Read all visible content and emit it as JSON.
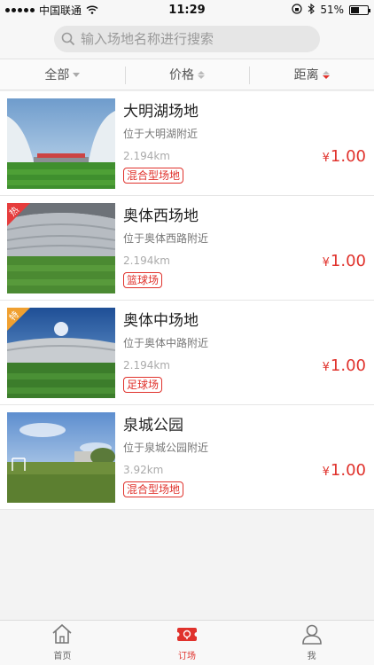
{
  "status_bar": {
    "carrier": "中国联通",
    "time": "11:29",
    "battery": "51%",
    "battery_level": 0.51
  },
  "search": {
    "placeholder": "输入场地名称进行搜索"
  },
  "filters": [
    {
      "label": "全部",
      "indicator": "dropdown"
    },
    {
      "label": "价格",
      "indicator": "sort"
    },
    {
      "label": "距离",
      "indicator": "sort-active-desc"
    }
  ],
  "venues": [
    {
      "name": "大明湖场地",
      "location": "位于大明湖附近",
      "distance": "2.194km",
      "tag": "混合型场地",
      "price_symbol": "¥",
      "price": "1.00",
      "badge": ""
    },
    {
      "name": "奥体西场地",
      "location": "位于奥体西路附近",
      "distance": "2.194km",
      "tag": "篮球场",
      "price_symbol": "¥",
      "price": "1.00",
      "badge": "热"
    },
    {
      "name": "奥体中场地",
      "location": "位于奥体中路附近",
      "distance": "2.194km",
      "tag": "足球场",
      "price_symbol": "¥",
      "price": "1.00",
      "badge": "特"
    },
    {
      "name": "泉城公园",
      "location": "位于泉城公园附近",
      "distance": "3.92km",
      "tag": "混合型场地",
      "price_symbol": "¥",
      "price": "1.00",
      "badge": ""
    }
  ],
  "tabs": [
    {
      "label": "首页",
      "icon": "home-icon"
    },
    {
      "label": "订场",
      "icon": "ticket-icon",
      "active": true
    },
    {
      "label": "我",
      "icon": "user-icon"
    }
  ],
  "colors": {
    "accent": "#e0322c",
    "hot_badge": "#e63c3c",
    "special_badge": "#f0a030"
  }
}
